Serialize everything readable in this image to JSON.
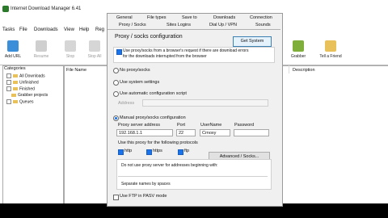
{
  "window": {
    "title": "Internet Download Manager 6.41"
  },
  "menu": [
    "Tasks",
    "File",
    "Downloads",
    "View",
    "Help",
    "Reg"
  ],
  "toolbar": {
    "left": [
      "Add URL",
      "Resume",
      "Stop",
      "Stop All"
    ],
    "right": [
      "Grabber",
      "Tell a Friend"
    ]
  },
  "categories": {
    "title": "Categories",
    "items": [
      "All Downloads",
      "Unfinished",
      "Finished",
      "Grabber projects",
      "Queues"
    ]
  },
  "list_columns": {
    "file": "File Name",
    "desc": "Description"
  },
  "dialog": {
    "tabs_row1": [
      "General",
      "File types",
      "Save to",
      "Downloads",
      "Connection"
    ],
    "tabs_row2": [
      "Proxy / Socks",
      "Sites Logins",
      "Dial Up / VPN",
      "Sounds"
    ],
    "heading": "Proxy / socks configuration",
    "get_system": "Get System",
    "wrap_text_1": "Use proxy/socks from a browser's request if there are download errors",
    "wrap_text_2": "for the downloads interrupted from the browser",
    "no_proxy": "No proxy/socks",
    "system_settings": "Use system settings",
    "auto_script": "Use automatic configuration script",
    "address_label": "Address",
    "manual": "Manual proxy/socks configuration",
    "labels": {
      "server": "Proxy server address",
      "port": "Port",
      "username": "UserName",
      "password": "Password"
    },
    "values": {
      "server": "192.168.1.1",
      "port": "22",
      "username": "Crnoxy",
      "password": ""
    },
    "protocols_label": "Use this proxy for the following protocols",
    "protocols": [
      "http",
      "https",
      "ftp"
    ],
    "advanced": "Advanced / Socks...",
    "bypass_label": "Do not use proxy server for addresses beginning with:",
    "separate": "Separate names by spaces",
    "ftp_pasv": "Use FTP in PASV mode"
  }
}
